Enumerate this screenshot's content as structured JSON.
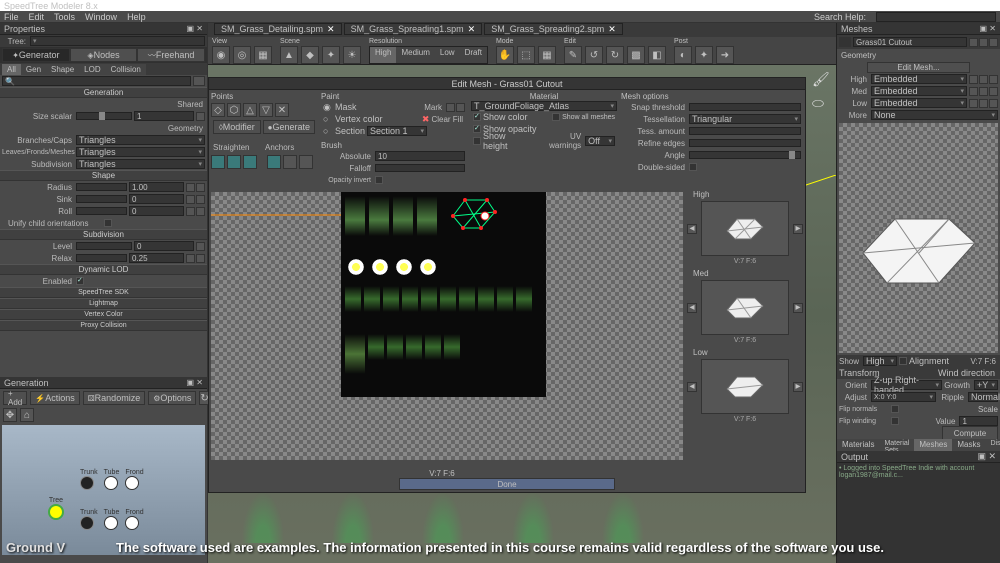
{
  "app": {
    "title": "SpeedTree Modeler 8.x"
  },
  "menu": [
    "File",
    "Edit",
    "Tools",
    "Window",
    "Help"
  ],
  "searchHelp": {
    "label": "Search Help:"
  },
  "properties": {
    "title": "Properties",
    "treeLabel": "Tree:",
    "modeButtons": {
      "generator": "Generator",
      "nodes": "Nodes",
      "freehand": "Freehand"
    },
    "filterTabs": [
      "All",
      "Gen",
      "Shape",
      "LOD",
      "Collision"
    ],
    "sections": {
      "generation": "Generation",
      "shared": "Shared",
      "sizeScalar": "Size scalar",
      "sizeScalarVal": "1",
      "geometry": "Geometry",
      "branchesCaps": "Branches/Caps",
      "leavesFrondMeshes": "Leaves/Fronds/Meshes",
      "subdivision": "Subdivision",
      "triangles": "Triangles",
      "shape": "Shape",
      "radius": "Radius",
      "radiusVal": "1.00",
      "sink": "Sink",
      "sinkVal": "0",
      "roll": "Roll",
      "rollVal": "0",
      "unifyChild": "Unify child orientations",
      "subdivision2": "Subdivision",
      "level": "Level",
      "levelVal": "0",
      "relax": "Relax",
      "relaxVal": "0.25",
      "dynamicLOD": "Dynamic LOD",
      "enabled": "Enabled",
      "speedtreeSDK": "SpeedTree SDK",
      "lightmap": "Lightmap",
      "vertexColor": "Vertex Color",
      "proxyCollision": "Proxy Collision"
    }
  },
  "generation": {
    "title": "Generation",
    "buttons": {
      "add": "+ Add",
      "actions": "Actions",
      "randomize": "Randomize",
      "options": "Options"
    },
    "nodes": {
      "trunk": "Trunk",
      "tube": "Tube",
      "frond": "Frond",
      "tree": "Tree"
    }
  },
  "tabs": [
    {
      "name": "SM_Grass_Detailing.spm"
    },
    {
      "name": "SM_Grass_Spreading1.spm"
    },
    {
      "name": "SM_Grass_Spreading2.spm"
    }
  ],
  "viewToolbar": {
    "groups": {
      "view": "View",
      "scene": "Scene",
      "resolution": "Resolution",
      "mode": "Mode",
      "edit": "Edit",
      "post": "Post"
    },
    "resOptions": [
      "High",
      "Medium",
      "Low",
      "Draft"
    ]
  },
  "editMesh": {
    "title": "Edit Mesh - Grass01 Cutout",
    "pointsLabel": "Points",
    "paintLabel": "Paint",
    "maskLabel": "Mask",
    "vertexColorLabel": "Vertex color",
    "section": "Section",
    "sectionVal": "Section 1",
    "brushLabel": "Brush",
    "modifier": "Modifier",
    "generate": "Generate",
    "straighten": "Straighten",
    "anchors": "Anchors",
    "absolute": "Absolute",
    "falloff": "Falloff",
    "opacityInvert": "Opacity invert",
    "materialLabel": "Material",
    "materialVal": "T_GroundFoliage_Atlas",
    "showColor": "Show color",
    "showOpacity": "Show opacity",
    "showHeight": "Show height",
    "showAllMeshes": "Show all meshes",
    "uvWarnings": "UV warnings",
    "uvVal": "Off",
    "meshOptions": "Mesh options",
    "snapThreshold": "Snap threshold",
    "tessellation": "Tessellation",
    "tessVal": "Triangular",
    "tessAmount": "Tess. amount",
    "refineEdges": "Refine edges",
    "angle": "Angle",
    "doubleSided": "Double-sided",
    "highLabel": "High",
    "medLabel": "Med",
    "lowLabel": "Low",
    "lodCaption": "V:7 F:6",
    "markLabel": "Mark",
    "clearFill": "Clear Fill",
    "done": "Done"
  },
  "meshesPanel": {
    "title": "Meshes",
    "selected": "Grass01 Cutout",
    "editBtn": "Edit Mesh...",
    "geometryLabel": "Geometry",
    "rows": {
      "high": "High",
      "med": "Med",
      "low": "Low",
      "more": "More"
    },
    "embedded": "Embedded",
    "none": "None",
    "showLabel": "Show",
    "showVal": "High",
    "alignment": "Alignment",
    "lodCaption": "V:7 F:6",
    "transform": "Transform",
    "windDir": "Wind direction",
    "orient": "Orient",
    "orientVal": "Z-up Right-handed",
    "growth": "Growth",
    "growthVal": "+Y",
    "adjust": "Adjust",
    "ripple": "Ripple",
    "rippleVal": "Normal",
    "flipNormals": "Flip normals",
    "flipWinding": "Flip winding",
    "scale": "Scale",
    "value": "Value",
    "valueNum": "1",
    "compute": "Compute",
    "bottomTabs": [
      "Materials",
      "Material Sets",
      "Meshes",
      "Masks",
      "Displacements"
    ]
  },
  "output": {
    "title": "Output",
    "msg": "• Logged into SpeedTree Indie with account logan1987@mail.c..."
  },
  "subtitle": "The software used are examples. The information presented in this course remains valid regardless of the software you use.",
  "groundLabel": "Ground V"
}
